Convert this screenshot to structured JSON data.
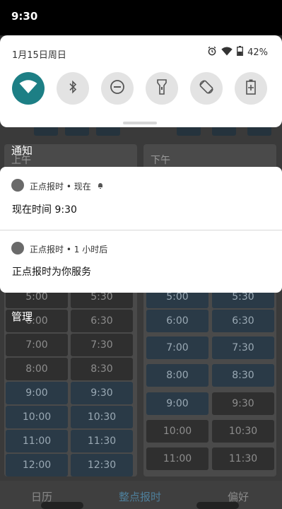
{
  "status_bar": {
    "time": "9:30"
  },
  "quick_settings": {
    "date": "1月15日周日",
    "battery": "42%",
    "tiles": [
      {
        "icon": "wifi-icon",
        "on": true
      },
      {
        "icon": "bluetooth-icon",
        "on": false
      },
      {
        "icon": "do-not-disturb-icon",
        "on": false
      },
      {
        "icon": "flashlight-icon",
        "on": false
      },
      {
        "icon": "auto-rotate-icon",
        "on": false
      },
      {
        "icon": "battery-saver-icon",
        "on": false
      }
    ]
  },
  "sections": {
    "notifications": "通知",
    "manage": "管理"
  },
  "notifications": [
    {
      "app": "正点报时",
      "when": "现在",
      "text": "现在时间 9:30"
    },
    {
      "app": "正点报时",
      "when": "1 小时后",
      "text": "正点报时为你服务"
    }
  ],
  "background_app": {
    "morning_header": "上午",
    "afternoon_header": "下午",
    "morning_slots": [
      "5:00",
      "5:30",
      "6:00",
      "6:30",
      "7:00",
      "7:30",
      "8:00",
      "8:30",
      "9:00",
      "9:30",
      "10:00",
      "10:30",
      "11:00",
      "11:30",
      "12:00",
      "12:30"
    ],
    "afternoon_slots": [
      "5:00",
      "5:30",
      "6:00",
      "6:30",
      "7:00",
      "7:30",
      "8:00",
      "8:30",
      "9:00",
      "9:30",
      "10:00",
      "10:30",
      "11:00",
      "11:30"
    ],
    "tabs": [
      "日历",
      "整点报时",
      "偏好"
    ],
    "colors": {
      "accent": "#1d7f85",
      "active_tab": "#4e7f9b"
    }
  }
}
